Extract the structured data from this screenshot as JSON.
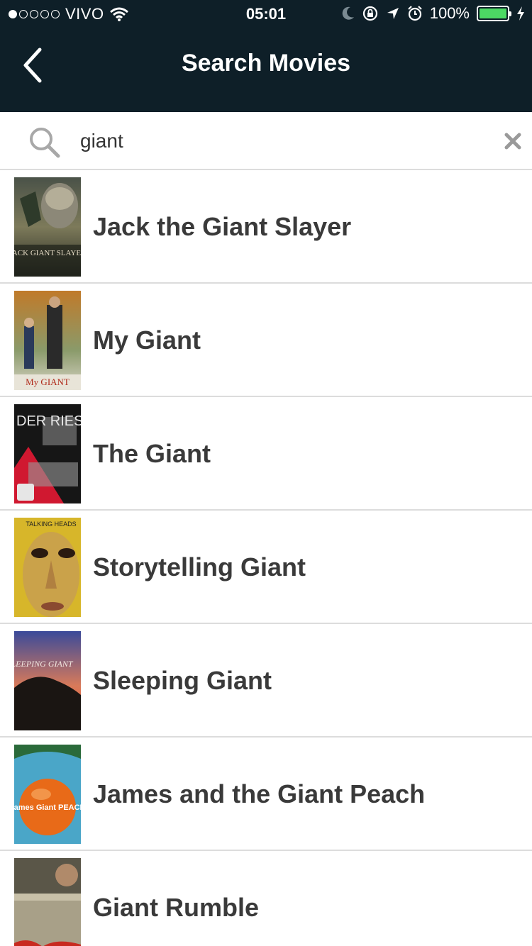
{
  "status_bar": {
    "carrier": "VIVO",
    "time": "05:01",
    "battery_percent": "100%",
    "signal_bars_filled": 1,
    "signal_bars_total": 5,
    "battery_color": "#4cd964"
  },
  "nav": {
    "title": "Search Movies",
    "back_icon": "chevron-left-icon",
    "background_color": "#0e1f28"
  },
  "search": {
    "value": "giant",
    "placeholder": "",
    "search_icon": "search-icon",
    "clear_icon": "close-icon"
  },
  "results": [
    {
      "title": "Jack the Giant Slayer",
      "poster_text": "JACK GIANT SLAYER"
    },
    {
      "title": "My Giant",
      "poster_text": "My GIANT"
    },
    {
      "title": "The Giant",
      "poster_text": "DER RIESE"
    },
    {
      "title": "Storytelling Giant",
      "poster_text": "TALKING HEADS"
    },
    {
      "title": "Sleeping Giant",
      "poster_text": "SLEEPING GIANT"
    },
    {
      "title": "James and the Giant Peach",
      "poster_text": "James Giant PEACH"
    },
    {
      "title": "Giant Rumble",
      "poster_text": ""
    }
  ]
}
